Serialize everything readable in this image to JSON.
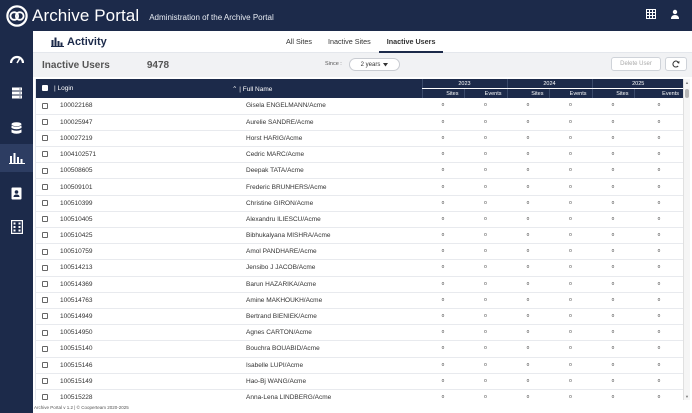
{
  "app": {
    "title": "Archive Portal",
    "subtitle": "Administration of the Archive Portal"
  },
  "topbar_icons": [
    "grid-icon",
    "user-icon"
  ],
  "sidebar": {
    "items": [
      {
        "name": "dashboard-icon",
        "active": false
      },
      {
        "name": "servers-icon",
        "active": false
      },
      {
        "name": "database-icon",
        "active": false
      },
      {
        "name": "activity-chart-icon",
        "active": true
      },
      {
        "name": "contacts-icon",
        "active": false
      },
      {
        "name": "building-icon",
        "active": false
      }
    ]
  },
  "header": {
    "title": "Activity",
    "tabs": [
      {
        "label": "All Sites",
        "active": false
      },
      {
        "label": "Inactive Sites",
        "active": false
      },
      {
        "label": "Inactive Users",
        "active": true
      }
    ]
  },
  "subheader": {
    "title": "Inactive Users",
    "count": "9478",
    "since_label": "Since :",
    "since_value": "2 years",
    "delete_label": "Delete User"
  },
  "table": {
    "login_header": "| Login",
    "fullname_header": "| Full Name",
    "years": [
      "2023",
      "2024",
      "2025"
    ],
    "metrics": [
      "Sites",
      "Events"
    ],
    "rows": [
      {
        "login": "100022168",
        "name": "Gisela ENGELMANN/Acme",
        "vals": [
          "0",
          "0",
          "0",
          "0",
          "0",
          "0"
        ]
      },
      {
        "login": "100025947",
        "name": "Aurelie SANDRE/Acme",
        "vals": [
          "0",
          "0",
          "0",
          "0",
          "0",
          "0"
        ]
      },
      {
        "login": "100027219",
        "name": "Horst HARIG/Acme",
        "vals": [
          "0",
          "0",
          "0",
          "0",
          "0",
          "0"
        ]
      },
      {
        "login": "1004102571",
        "name": "Cedric MARC/Acme",
        "vals": [
          "0",
          "0",
          "0",
          "0",
          "0",
          "0"
        ]
      },
      {
        "login": "100508605",
        "name": "Deepak TATA/Acme",
        "vals": [
          "0",
          "0",
          "0",
          "0",
          "0",
          "0"
        ]
      },
      {
        "login": "100509101",
        "name": "Frederic BRUNHERS/Acme",
        "vals": [
          "0",
          "0",
          "0",
          "0",
          "0",
          "0"
        ]
      },
      {
        "login": "100510399",
        "name": "Christine GIRON/Acme",
        "vals": [
          "0",
          "0",
          "0",
          "0",
          "0",
          "0"
        ]
      },
      {
        "login": "100510405",
        "name": "Alexandru ILIESCU/Acme",
        "vals": [
          "0",
          "0",
          "0",
          "0",
          "0",
          "0"
        ]
      },
      {
        "login": "100510425",
        "name": "Bibhukalyana MISHRA/Acme",
        "vals": [
          "0",
          "0",
          "0",
          "0",
          "0",
          "0"
        ]
      },
      {
        "login": "100510759",
        "name": "Amol PANDHARE/Acme",
        "vals": [
          "0",
          "0",
          "0",
          "0",
          "0",
          "0"
        ]
      },
      {
        "login": "100514213",
        "name": "Jensibo J JACOB/Acme",
        "vals": [
          "0",
          "0",
          "0",
          "0",
          "0",
          "0"
        ]
      },
      {
        "login": "100514369",
        "name": "Barun HAZARIKA/Acme",
        "vals": [
          "0",
          "0",
          "0",
          "0",
          "0",
          "0"
        ]
      },
      {
        "login": "100514763",
        "name": "Amine MAKHOUKH/Acme",
        "vals": [
          "0",
          "0",
          "0",
          "0",
          "0",
          "0"
        ]
      },
      {
        "login": "100514949",
        "name": "Bertrand BIENIEK/Acme",
        "vals": [
          "0",
          "0",
          "0",
          "0",
          "0",
          "0"
        ]
      },
      {
        "login": "100514950",
        "name": "Agnes CARTON/Acme",
        "vals": [
          "0",
          "0",
          "0",
          "0",
          "0",
          "0"
        ]
      },
      {
        "login": "100515140",
        "name": "Bouchra BOUABID/Acme",
        "vals": [
          "0",
          "0",
          "0",
          "0",
          "0",
          "0"
        ]
      },
      {
        "login": "100515146",
        "name": "Isabelle LUPI/Acme",
        "vals": [
          "0",
          "0",
          "0",
          "0",
          "0",
          "0"
        ]
      },
      {
        "login": "100515149",
        "name": "Hao-Bj WANG/Acme",
        "vals": [
          "0",
          "0",
          "0",
          "0",
          "0",
          "0"
        ]
      },
      {
        "login": "100515228",
        "name": "Anna-Lena LINDBERG/Acme",
        "vals": [
          "0",
          "0",
          "0",
          "0",
          "0",
          "0"
        ]
      }
    ]
  },
  "footer": "Archive Portal v 1.2 | © Cooperteam 2020-2025",
  "colors": {
    "navy": "#1c2a4a",
    "active_side": "#2d3d62"
  }
}
